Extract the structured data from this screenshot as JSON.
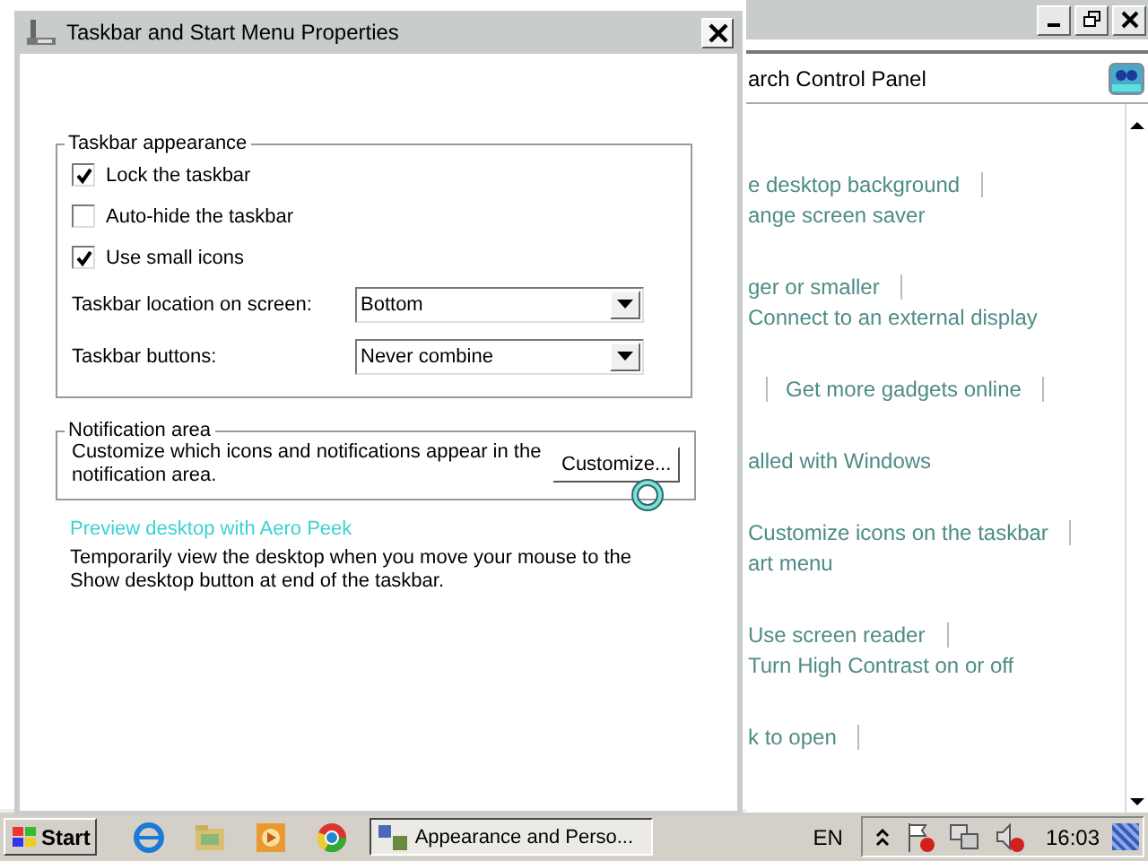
{
  "background_window": {
    "search_text": "arch Control Panel",
    "sections": [
      {
        "links": [
          {
            "text": "e desktop background",
            "separator": true,
            "lead_separator": false
          },
          {
            "text": "ange screen saver",
            "separator": false,
            "lead_separator": false
          }
        ]
      },
      {
        "links": [
          {
            "text": "ger or smaller",
            "separator": true,
            "lead_separator": false
          },
          {
            "text": "Connect to an external display",
            "separator": false,
            "lead_separator": false
          }
        ]
      },
      {
        "links": [
          {
            "text": "Get more gadgets online",
            "separator": true,
            "lead_separator": true
          }
        ]
      },
      {
        "links": [
          {
            "text": "alled with Windows",
            "separator": false,
            "lead_separator": false
          }
        ]
      },
      {
        "links": [
          {
            "text": "Customize icons on the taskbar",
            "separator": true,
            "lead_separator": false
          },
          {
            "text": "art menu",
            "separator": false,
            "lead_separator": false
          }
        ]
      },
      {
        "links": [
          {
            "text": "Use screen reader",
            "separator": true,
            "lead_separator": false
          },
          {
            "text": "Turn High Contrast on or off",
            "separator": false,
            "lead_separator": false
          }
        ]
      },
      {
        "links": [
          {
            "text": "k to open",
            "separator": true,
            "lead_separator": false
          }
        ]
      }
    ]
  },
  "dialog": {
    "title": "Taskbar and Start Menu Properties",
    "appearance": {
      "legend": "Taskbar appearance",
      "options": [
        {
          "label": "Lock the taskbar",
          "checked": true
        },
        {
          "label": "Auto-hide the taskbar",
          "checked": false
        },
        {
          "label": "Use small icons",
          "checked": true
        }
      ],
      "selects": [
        {
          "label": "Taskbar location on screen:",
          "value": "Bottom"
        },
        {
          "label": "Taskbar buttons:",
          "value": "Never combine"
        }
      ]
    },
    "notification": {
      "legend": "Notification area",
      "text": "Customize which icons and notifications appear in the notification area.",
      "button": "Customize..."
    },
    "aero_peek": {
      "link": "Preview desktop with Aero Peek",
      "text": "Temporarily view the desktop when you move your mouse to the Show desktop button at end of the taskbar."
    }
  },
  "taskbar": {
    "start": "Start",
    "task": "Appearance and Perso...",
    "language": "EN",
    "clock": "16:03"
  }
}
